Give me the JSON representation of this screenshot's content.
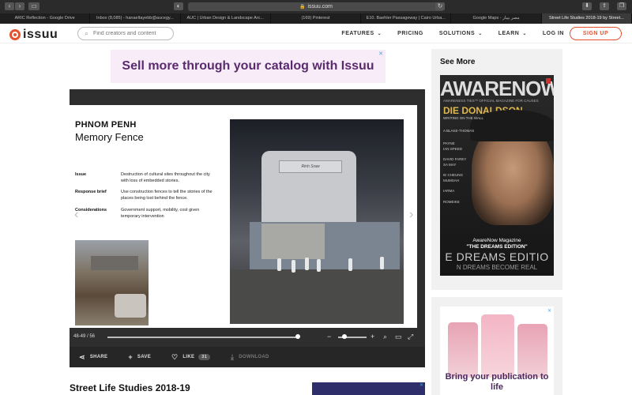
{
  "browser": {
    "url": "issuu.com",
    "tabs": [
      {
        "label": "ARIC Reflection - Google Drive",
        "active": false
      },
      {
        "label": "Inbox (8,085) - hanaeltayebb@aucegy...",
        "active": false
      },
      {
        "label": "AUC | Urban Design & Landscape Arc...",
        "active": false
      },
      {
        "label": "(169) Pinterest",
        "active": false
      },
      {
        "label": "E10. Baehler Passageway | Cairo Urba...",
        "active": false
      },
      {
        "label": "Google Maps - مصر بيبار",
        "active": false
      },
      {
        "label": "Street Life Studies 2018-19 by Street...",
        "active": true
      }
    ]
  },
  "header": {
    "logo_text": "issuu",
    "search_placeholder": "Find creators and content",
    "nav": [
      {
        "label": "FEATURES",
        "dropdown": true
      },
      {
        "label": "PRICING",
        "dropdown": false
      },
      {
        "label": "SOLUTIONS",
        "dropdown": true
      },
      {
        "label": "LEARN",
        "dropdown": true
      },
      {
        "label": "LOG IN",
        "dropdown": false
      }
    ],
    "signup_label": "SIGN UP"
  },
  "banner": {
    "text": "Sell more through your catalog with Issuu"
  },
  "page": {
    "title_city": "PHNOM PENH",
    "title_project": "Memory Fence",
    "rows": [
      {
        "label": "Issue",
        "text": "Destruction of cultural sites throughout the city with loss of embedded stories."
      },
      {
        "label": "Response brief",
        "text": "Use construction fences to tell the stories of the places being lost behind the fence."
      },
      {
        "label": "Considerations",
        "text": "Government support, mobility, cost given temporary intervention"
      }
    ],
    "building_sign": "Rinh Sraw"
  },
  "controls": {
    "page_indicator": "48-49 / 56"
  },
  "actions": {
    "share": "SHARE",
    "save": "SAVE",
    "like": "LIKE",
    "like_count": "31",
    "download": "DOWNLOAD"
  },
  "document": {
    "title": "Street Life Studies 2018-19"
  },
  "sidebar": {
    "title": "See More",
    "magazine": {
      "brand": "AWARENOW",
      "tagline": "AWARENESS TIES™ OFFICIAL MAGAZINE FOR CAUSES",
      "cover_name": "DIE DONALDSON",
      "side_lines": [
        "WRITING ON THE WALL",
        "A BLAKE-THOMAS",
        "PAYNE",
        "IAN SPEED",
        "DAVID FAREY",
        "SA MAY",
        "IE CHEUNG",
        "MUMSAH",
        "IARMA",
        "ROMEIKE"
      ],
      "caption": "AwareNow Magazine",
      "caption2": "\"THE DREAMS EDITION\"",
      "big": "E DREAMS EDITIO",
      "foot": "N DREAMS BECOME REAL"
    },
    "ad2": {
      "text": "Bring your publication to life"
    }
  }
}
